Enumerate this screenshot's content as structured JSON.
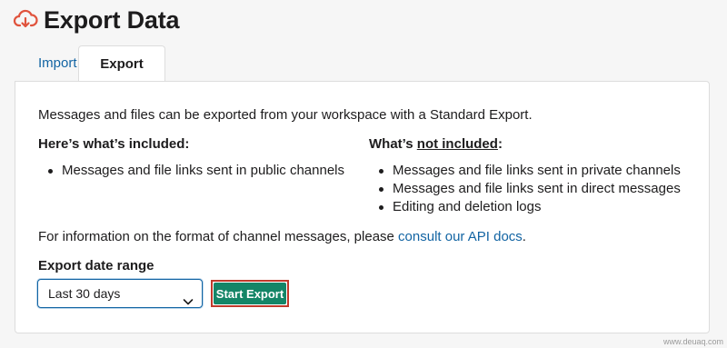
{
  "header": {
    "title": "Export Data",
    "icon": "cloud-download-icon",
    "icon_color": "#e0533d"
  },
  "tabs": [
    {
      "label": "Import",
      "active": false
    },
    {
      "label": "Export",
      "active": true
    }
  ],
  "panel": {
    "intro": "Messages and files can be exported from your workspace with a Standard Export.",
    "included_heading": "Here’s what’s included:",
    "not_included_heading_prefix": "What’s ",
    "not_included_heading_underlined": "not included",
    "not_included_heading_suffix": ":",
    "included_items": [
      "Messages and file links sent in public channels"
    ],
    "not_included_items": [
      "Messages and file links sent in private channels",
      "Messages and file links sent in direct messages",
      "Editing and deletion logs"
    ],
    "info_text": "For information on the format of channel messages, please ",
    "info_link": "consult our API docs",
    "info_suffix": ".",
    "range_label": "Export date range",
    "range_value": "Last 30 days",
    "start_button": "Start Export"
  },
  "colors": {
    "accent": "#1264a3",
    "button": "#148567",
    "highlight_border": "#c0392b"
  },
  "watermark": "www.deuaq.com"
}
